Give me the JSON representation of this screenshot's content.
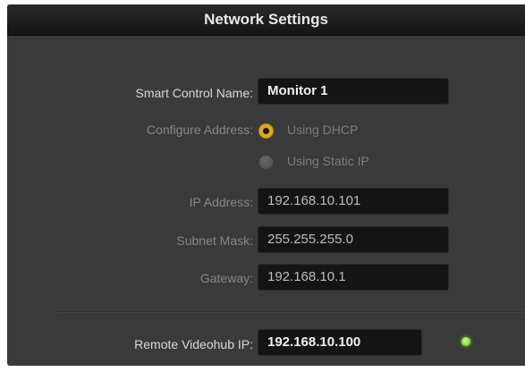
{
  "window": {
    "title": "Network Settings"
  },
  "settings": {
    "smart_control_name": {
      "label": "Smart Control Name:",
      "value": "Monitor 1"
    },
    "configure_address": {
      "label": "Configure Address:",
      "options": [
        "Using DHCP",
        "Using Static IP"
      ],
      "selected": "Using DHCP"
    },
    "ip_address": {
      "label": "IP Address:",
      "value": "192.168.10.101"
    },
    "subnet_mask": {
      "label": "Subnet Mask:",
      "value": "255.255.255.0"
    },
    "gateway": {
      "label": "Gateway:",
      "value": "192.168.10.1"
    },
    "remote_videohub_ip": {
      "label": "Remote Videohub IP:",
      "value": "192.168.10.100"
    }
  },
  "colors": {
    "panel_bg": "#3a3a3a",
    "field_bg": "#141414",
    "radio_selected": "#e0a81c",
    "status_connected": "#5cc41c"
  },
  "icons": {
    "connection_status": "green-status-led"
  }
}
